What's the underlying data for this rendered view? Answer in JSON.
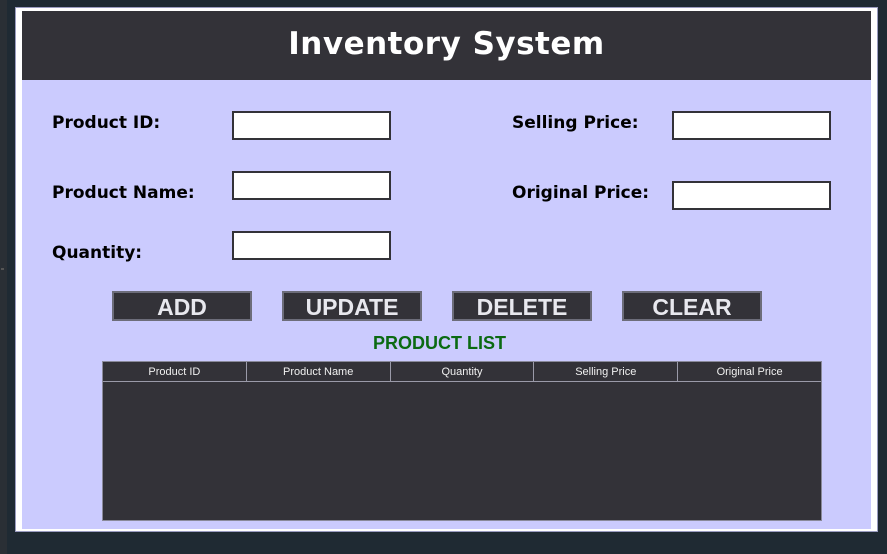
{
  "header": {
    "title": "Inventory System"
  },
  "form": {
    "product_id": {
      "label": "Product ID:",
      "value": ""
    },
    "product_name": {
      "label": "Product Name:",
      "value": ""
    },
    "quantity": {
      "label": "Quantity:",
      "value": ""
    },
    "selling_price": {
      "label": "Selling Price:",
      "value": ""
    },
    "original_price": {
      "label": "Original Price:",
      "value": ""
    }
  },
  "buttons": {
    "add": "ADD",
    "update": "UPDATE",
    "delete": "DELETE",
    "clear": "CLEAR"
  },
  "product_list": {
    "title": "PRODUCT LIST",
    "columns": [
      "Product ID",
      "Product Name",
      "Quantity",
      "Selling Price",
      "Original Price"
    ],
    "rows": []
  },
  "colors": {
    "panel_bg": "#cbcbfe",
    "header_bg": "#333238",
    "list_title": "#0b6a12"
  }
}
